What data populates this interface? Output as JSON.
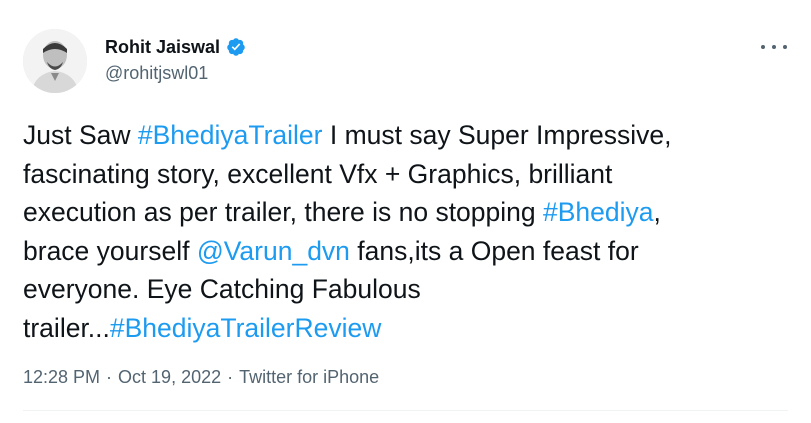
{
  "author": {
    "display_name": "Rohit Jaiswal",
    "handle": "@rohitjswl01",
    "verified": true
  },
  "tweet": {
    "lines": [
      [
        {
          "text": "Just Saw ",
          "link": false
        },
        {
          "text": "#BhediyaTrailer",
          "link": true
        },
        {
          "text": " I must say Super Impressive,",
          "link": false
        }
      ],
      [
        {
          "text": "fascinating story, excellent Vfx + Graphics, brilliant",
          "link": false
        }
      ],
      [
        {
          "text": "execution as per trailer, there is no stopping ",
          "link": false
        },
        {
          "text": "#Bhediya",
          "link": true
        },
        {
          "text": ",",
          "link": false
        }
      ],
      [
        {
          "text": "brace yourself ",
          "link": false
        },
        {
          "text": "@Varun_dvn",
          "link": true
        },
        {
          "text": " fans,its a Open feast for",
          "link": false
        }
      ],
      [
        {
          "text": "everyone. Eye Catching Fabulous",
          "link": false
        }
      ],
      [
        {
          "text": "trailer...",
          "link": false
        },
        {
          "text": "#BhediyaTrailerReview",
          "link": true
        }
      ]
    ]
  },
  "meta": {
    "time": "12:28 PM",
    "separator": "·",
    "date": "Oct 19, 2022",
    "source": "Twitter for iPhone"
  },
  "colors": {
    "link": "#1d9bf0",
    "secondary_text": "#536471",
    "verified_badge": "#1d9bf0"
  },
  "icons": {
    "verified": "verified-badge-icon",
    "more": "more-options-icon"
  }
}
